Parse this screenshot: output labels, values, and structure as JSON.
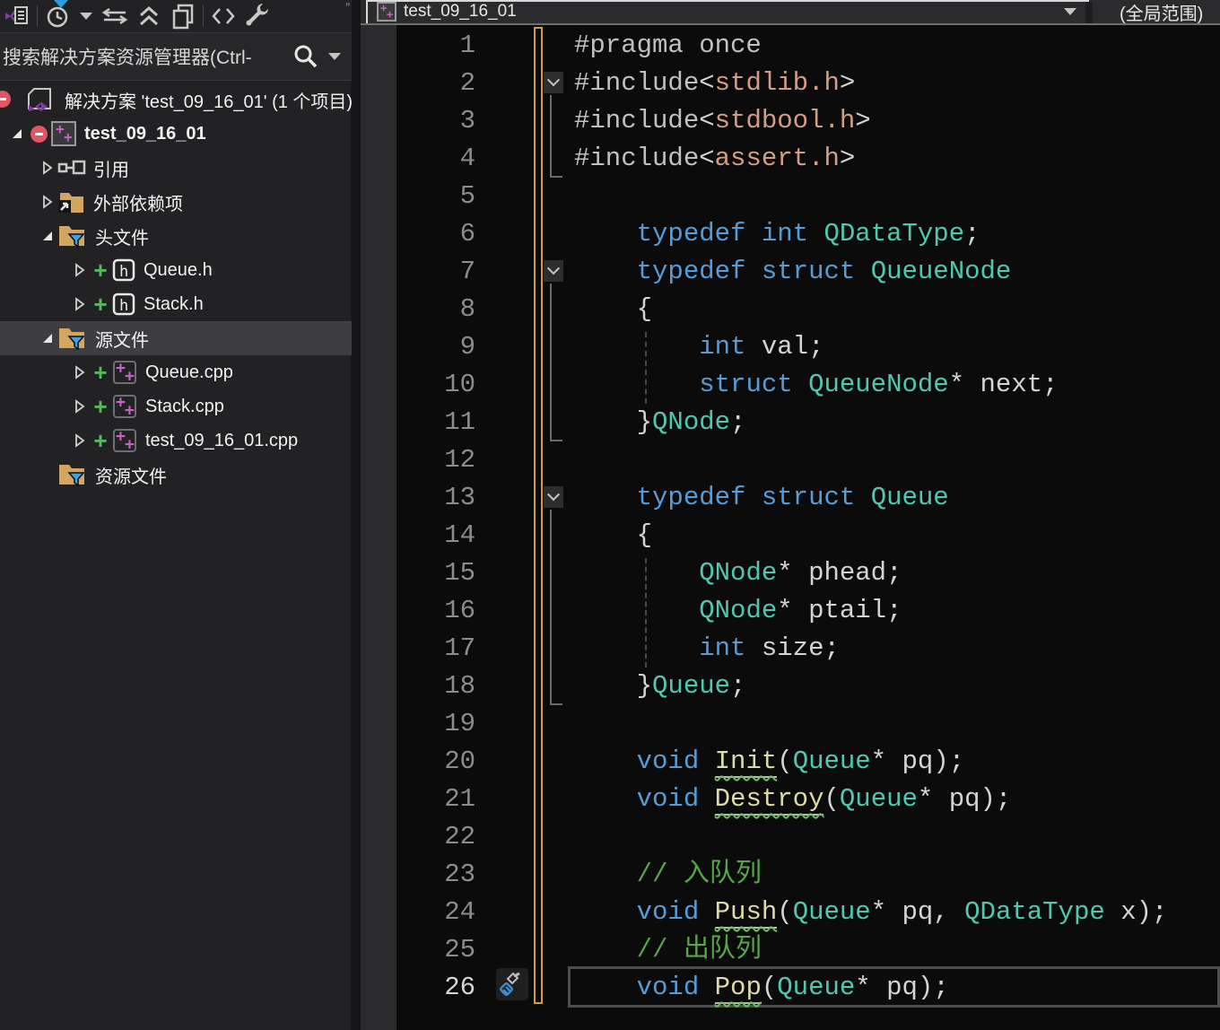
{
  "panel": {
    "title": "solution-explorer",
    "toolbar_icons": [
      "switch-views",
      "pending-changes-filter",
      "sync-with-active-document",
      "collapse-all",
      "show-all-files",
      "view-code",
      "properties"
    ],
    "search": {
      "placeholder": "搜索解决方案资源管理器(Ctrl-"
    }
  },
  "tree": {
    "items": [
      {
        "label": "解决方案 'test_09_16_01' (1 个项目)",
        "icon": "solution",
        "indent": 0,
        "expander": "none",
        "badge": "minus-edge",
        "bold": false,
        "selected": false
      },
      {
        "label": "test_09_16_01",
        "icon": "cpp-project",
        "indent": 0,
        "expander": "expanded",
        "badge": "minus",
        "bold": true,
        "selected": false
      },
      {
        "label": "引用",
        "icon": "references",
        "indent": 1,
        "expander": "collapsed",
        "badge": "",
        "bold": false,
        "selected": false
      },
      {
        "label": "外部依赖项",
        "icon": "external-deps",
        "indent": 1,
        "expander": "collapsed",
        "badge": "",
        "bold": false,
        "selected": false
      },
      {
        "label": "头文件",
        "icon": "filter-folder",
        "indent": 1,
        "expander": "expanded",
        "badge": "",
        "bold": false,
        "selected": false
      },
      {
        "label": "Queue.h",
        "icon": "h-file",
        "indent": 2,
        "expander": "collapsed",
        "badge": "plus",
        "bold": false,
        "selected": false
      },
      {
        "label": "Stack.h",
        "icon": "h-file",
        "indent": 2,
        "expander": "collapsed",
        "badge": "plus",
        "bold": false,
        "selected": false
      },
      {
        "label": "源文件",
        "icon": "filter-folder",
        "indent": 1,
        "expander": "expanded",
        "badge": "",
        "bold": false,
        "selected": true
      },
      {
        "label": "Queue.cpp",
        "icon": "cpp-file",
        "indent": 2,
        "expander": "collapsed",
        "badge": "plus",
        "bold": false,
        "selected": false
      },
      {
        "label": "Stack.cpp",
        "icon": "cpp-file",
        "indent": 2,
        "expander": "collapsed",
        "badge": "plus",
        "bold": false,
        "selected": false
      },
      {
        "label": "test_09_16_01.cpp",
        "icon": "cpp-file",
        "indent": 2,
        "expander": "collapsed",
        "badge": "plus",
        "bold": false,
        "selected": false
      },
      {
        "label": "资源文件",
        "icon": "filter-folder",
        "indent": 1,
        "expander": "none",
        "badge": "",
        "bold": false,
        "selected": false
      }
    ]
  },
  "navbar": {
    "project": "test_09_16_01",
    "scope": "(全局范围)"
  },
  "editor": {
    "current_line": 26,
    "fold_open_lines": [
      2,
      7,
      13
    ],
    "lines": [
      [
        [
          "pp",
          "#pragma once"
        ]
      ],
      [
        [
          "pp",
          "#include"
        ],
        [
          "pn",
          "<"
        ],
        [
          "str",
          "stdlib.h"
        ],
        [
          "pn",
          ">"
        ]
      ],
      [
        [
          "pp",
          "#include"
        ],
        [
          "pn",
          "<"
        ],
        [
          "str",
          "stdbool.h"
        ],
        [
          "pn",
          ">"
        ]
      ],
      [
        [
          "pp",
          "#include"
        ],
        [
          "pn",
          "<"
        ],
        [
          "str",
          "assert.h"
        ],
        [
          "pn",
          ">"
        ]
      ],
      [],
      [
        [
          "pn",
          "    "
        ],
        [
          "kw",
          "typedef"
        ],
        [
          "pn",
          " "
        ],
        [
          "kw",
          "int"
        ],
        [
          "pn",
          " "
        ],
        [
          "type",
          "QDataType"
        ],
        [
          "pn",
          ";"
        ]
      ],
      [
        [
          "pn",
          "    "
        ],
        [
          "kw",
          "typedef"
        ],
        [
          "pn",
          " "
        ],
        [
          "kw",
          "struct"
        ],
        [
          "pn",
          " "
        ],
        [
          "type",
          "QueueNode"
        ]
      ],
      [
        [
          "pn",
          "    {"
        ]
      ],
      [
        [
          "pn",
          "        "
        ],
        [
          "kw",
          "int"
        ],
        [
          "pn",
          " "
        ],
        [
          "id",
          "val"
        ],
        [
          "pn",
          ";"
        ]
      ],
      [
        [
          "pn",
          "        "
        ],
        [
          "kw",
          "struct"
        ],
        [
          "pn",
          " "
        ],
        [
          "type",
          "QueueNode"
        ],
        [
          "pn",
          "* "
        ],
        [
          "id",
          "next"
        ],
        [
          "pn",
          ";"
        ]
      ],
      [
        [
          "pn",
          "    }"
        ],
        [
          "type",
          "QNode"
        ],
        [
          "pn",
          ";"
        ]
      ],
      [],
      [
        [
          "pn",
          "    "
        ],
        [
          "kw",
          "typedef"
        ],
        [
          "pn",
          " "
        ],
        [
          "kw",
          "struct"
        ],
        [
          "pn",
          " "
        ],
        [
          "type",
          "Queue"
        ]
      ],
      [
        [
          "pn",
          "    {"
        ]
      ],
      [
        [
          "pn",
          "        "
        ],
        [
          "type",
          "QNode"
        ],
        [
          "pn",
          "* "
        ],
        [
          "id",
          "phead"
        ],
        [
          "pn",
          ";"
        ]
      ],
      [
        [
          "pn",
          "        "
        ],
        [
          "type",
          "QNode"
        ],
        [
          "pn",
          "* "
        ],
        [
          "id",
          "ptail"
        ],
        [
          "pn",
          ";"
        ]
      ],
      [
        [
          "pn",
          "        "
        ],
        [
          "kw",
          "int"
        ],
        [
          "pn",
          " "
        ],
        [
          "id",
          "size"
        ],
        [
          "pn",
          ";"
        ]
      ],
      [
        [
          "pn",
          "    }"
        ],
        [
          "type",
          "Queue"
        ],
        [
          "pn",
          ";"
        ]
      ],
      [],
      [
        [
          "pn",
          "    "
        ],
        [
          "kw",
          "void"
        ],
        [
          "pn",
          " "
        ],
        [
          "fn",
          "Init"
        ],
        [
          "pn",
          "("
        ],
        [
          "type",
          "Queue"
        ],
        [
          "pn",
          "* "
        ],
        [
          "id",
          "pq"
        ],
        [
          "pn",
          ");"
        ]
      ],
      [
        [
          "pn",
          "    "
        ],
        [
          "kw",
          "void"
        ],
        [
          "pn",
          " "
        ],
        [
          "fn",
          "Destroy"
        ],
        [
          "pn",
          "("
        ],
        [
          "type",
          "Queue"
        ],
        [
          "pn",
          "* "
        ],
        [
          "id",
          "pq"
        ],
        [
          "pn",
          ");"
        ]
      ],
      [],
      [
        [
          "pn",
          "    "
        ],
        [
          "cm",
          "// 入队列"
        ]
      ],
      [
        [
          "pn",
          "    "
        ],
        [
          "kw",
          "void"
        ],
        [
          "pn",
          " "
        ],
        [
          "fn",
          "Push"
        ],
        [
          "pn",
          "("
        ],
        [
          "type",
          "Queue"
        ],
        [
          "pn",
          "* "
        ],
        [
          "id",
          "pq"
        ],
        [
          "pn",
          ", "
        ],
        [
          "type",
          "QDataType"
        ],
        [
          "pn",
          " "
        ],
        [
          "id",
          "x"
        ],
        [
          "pn",
          ");"
        ]
      ],
      [
        [
          "pn",
          "    "
        ],
        [
          "cm",
          "// 出队列"
        ]
      ],
      [
        [
          "pn",
          "    "
        ],
        [
          "kw",
          "void"
        ],
        [
          "pn",
          " "
        ],
        [
          "fn",
          "Pop"
        ],
        [
          "pn",
          "("
        ],
        [
          "type",
          "Queue"
        ],
        [
          "pn",
          "* "
        ],
        [
          "id",
          "pq"
        ],
        [
          "pn",
          ");"
        ]
      ]
    ]
  },
  "colors": {
    "keyword": "#569CD6",
    "type": "#4EC9B0",
    "function": "#DCDCAA",
    "string": "#D69D85",
    "comment": "#57A64A",
    "squiggle": "#6ABF6A",
    "change_bar": "#C9A23F",
    "folder": "#D2A661",
    "funnel": "#3FA2E8",
    "added_plus": "#57B85A",
    "cpp_purple": "#C565C0",
    "badge_red": "#E25563",
    "selection_bg": "#3D3D42"
  }
}
